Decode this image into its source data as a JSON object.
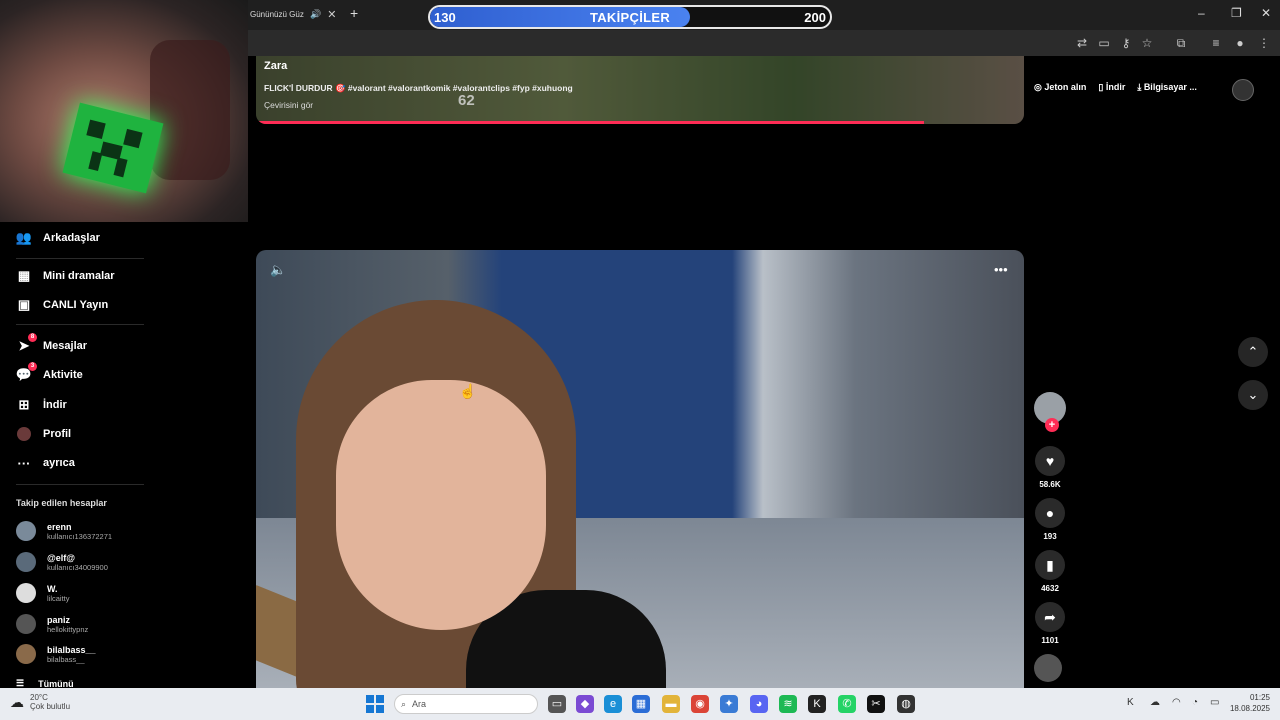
{
  "browser": {
    "tab_title": "Gününüzü Güz",
    "new_tab_icon": "plus-icon",
    "window_controls": [
      "minimize-icon",
      "restore-icon",
      "close-icon"
    ]
  },
  "goal_bar": {
    "start": "130",
    "title": "TAKİPÇİLER",
    "end": "200",
    "progress": 0.65
  },
  "sidebar": {
    "nav": [
      {
        "label": "Arkadaşlar",
        "icon": "friends-icon"
      },
      {
        "label": "Mini dramalar",
        "icon": "film-icon"
      },
      {
        "label": "CANLI Yayın",
        "icon": "live-tv-icon"
      },
      {
        "label": "Mesajlar",
        "icon": "send-icon",
        "badge": "8"
      },
      {
        "label": "Aktivite",
        "icon": "activity-icon",
        "badge": "3"
      },
      {
        "label": "İndir",
        "icon": "download-icon"
      },
      {
        "label": "Profil",
        "icon": "avatar-icon"
      },
      {
        "label": "ayrıca",
        "icon": "more-icon"
      }
    ],
    "following_title": "Takip edilen hesaplar",
    "accounts": [
      {
        "name": "erenn",
        "handle": "kullanıcı136372271"
      },
      {
        "name": "@elf@",
        "handle": "kullanıcı34009900"
      },
      {
        "name": "W.",
        "handle": "lilcaitty"
      },
      {
        "name": "paniz",
        "handle": "hellokittypnz"
      },
      {
        "name": "bilalbass__",
        "handle": "bilalbass__"
      }
    ],
    "see_all": "Tümünü"
  },
  "video_top": {
    "author": "Zara",
    "caption": "FLICK'İ DURDUR 🎯 #valorant #valorantkomik #valorantclips #fyp #xuhuong",
    "translate": "Çevirisini gör",
    "overlay_number": "62",
    "progress": 0.87
  },
  "header_links": {
    "coins": "Jeton alın",
    "download": "İndir",
    "desktop": "Bilgisayar ..."
  },
  "actions": {
    "likes": "58.6K",
    "comments": "193",
    "saves": "4632",
    "shares": "1101"
  },
  "taskbar": {
    "weather_temp": "20°C",
    "weather_desc": "Çok bulutlu",
    "search_placeholder": "Ara",
    "time": "01:25",
    "date": "18.08.2025"
  },
  "colors": {
    "accent": "#fe2c55",
    "goal_fill": "#3a6fe0",
    "background": "#000000"
  }
}
